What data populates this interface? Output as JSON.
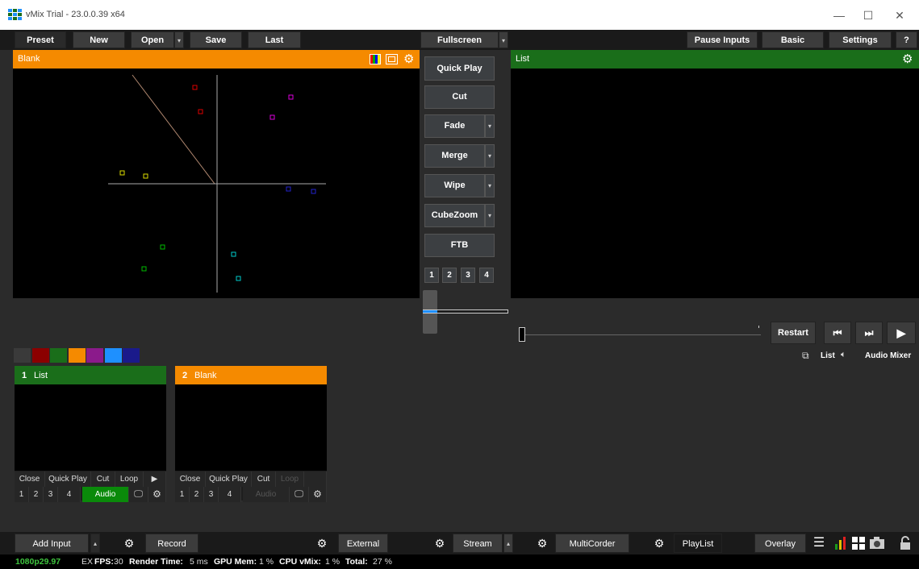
{
  "window": {
    "title": "vMix Trial - 23.0.0.39 x64",
    "minimize": "—",
    "maximize": "☐",
    "close": "✕"
  },
  "toolbar": {
    "preset": "Preset",
    "new": "New",
    "open": "Open",
    "save": "Save",
    "last": "Last",
    "fullscreen": "Fullscreen",
    "pause_inputs": "Pause Inputs",
    "basic": "Basic",
    "settings": "Settings",
    "help": "?"
  },
  "preview": {
    "title": "Blank"
  },
  "program": {
    "title": "List"
  },
  "transitions": {
    "quick_play": "Quick Play",
    "cut": "Cut",
    "fade": "Fade",
    "merge": "Merge",
    "wipe": "Wipe",
    "cubezoom": "CubeZoom",
    "ftb": "FTB",
    "numbers": [
      "1",
      "2",
      "3",
      "4"
    ]
  },
  "playback": {
    "restart": "Restart",
    "prev": "⏮",
    "next": "⏭",
    "play": "▶",
    "list": "List",
    "audio_mixer": "Audio Mixer"
  },
  "color_tabs": [
    "#3a3a3a",
    "#8b0000",
    "#1a6e1a",
    "#f58a00",
    "#8b1a8b",
    "#1e90ff",
    "#1a1a8b"
  ],
  "inputs": [
    {
      "number": "1",
      "name": "List",
      "color": "#1a6e1a",
      "close": "Close",
      "quick_play": "Quick Play",
      "cut": "Cut",
      "loop": "Loop",
      "play": "▶",
      "nums": [
        "1",
        "2",
        "3",
        "4"
      ],
      "audio": "Audio"
    },
    {
      "number": "2",
      "name": "Blank",
      "color": "#f58a00",
      "close": "Close",
      "quick_play": "Quick Play",
      "cut": "Cut",
      "loop": "Loop",
      "nums": [
        "1",
        "2",
        "3",
        "4"
      ],
      "audio": "Audio"
    }
  ],
  "bottom": {
    "add_input": "Add Input",
    "record": "Record",
    "external": "External",
    "stream": "Stream",
    "multicorder": "MultiCorder",
    "playlist": "PlayList",
    "overlay": "Overlay"
  },
  "status": {
    "format": "1080p29.97",
    "ex": "EX",
    "fps_label": "FPS:",
    "fps": "30",
    "render_label": "Render Time:",
    "render": "5 ms",
    "gpu_label": "GPU Mem:",
    "gpu": "1 %",
    "cpu_label": "CPU vMix:",
    "cpu": "1 %",
    "total_label": "Total:",
    "total": "27 %"
  }
}
